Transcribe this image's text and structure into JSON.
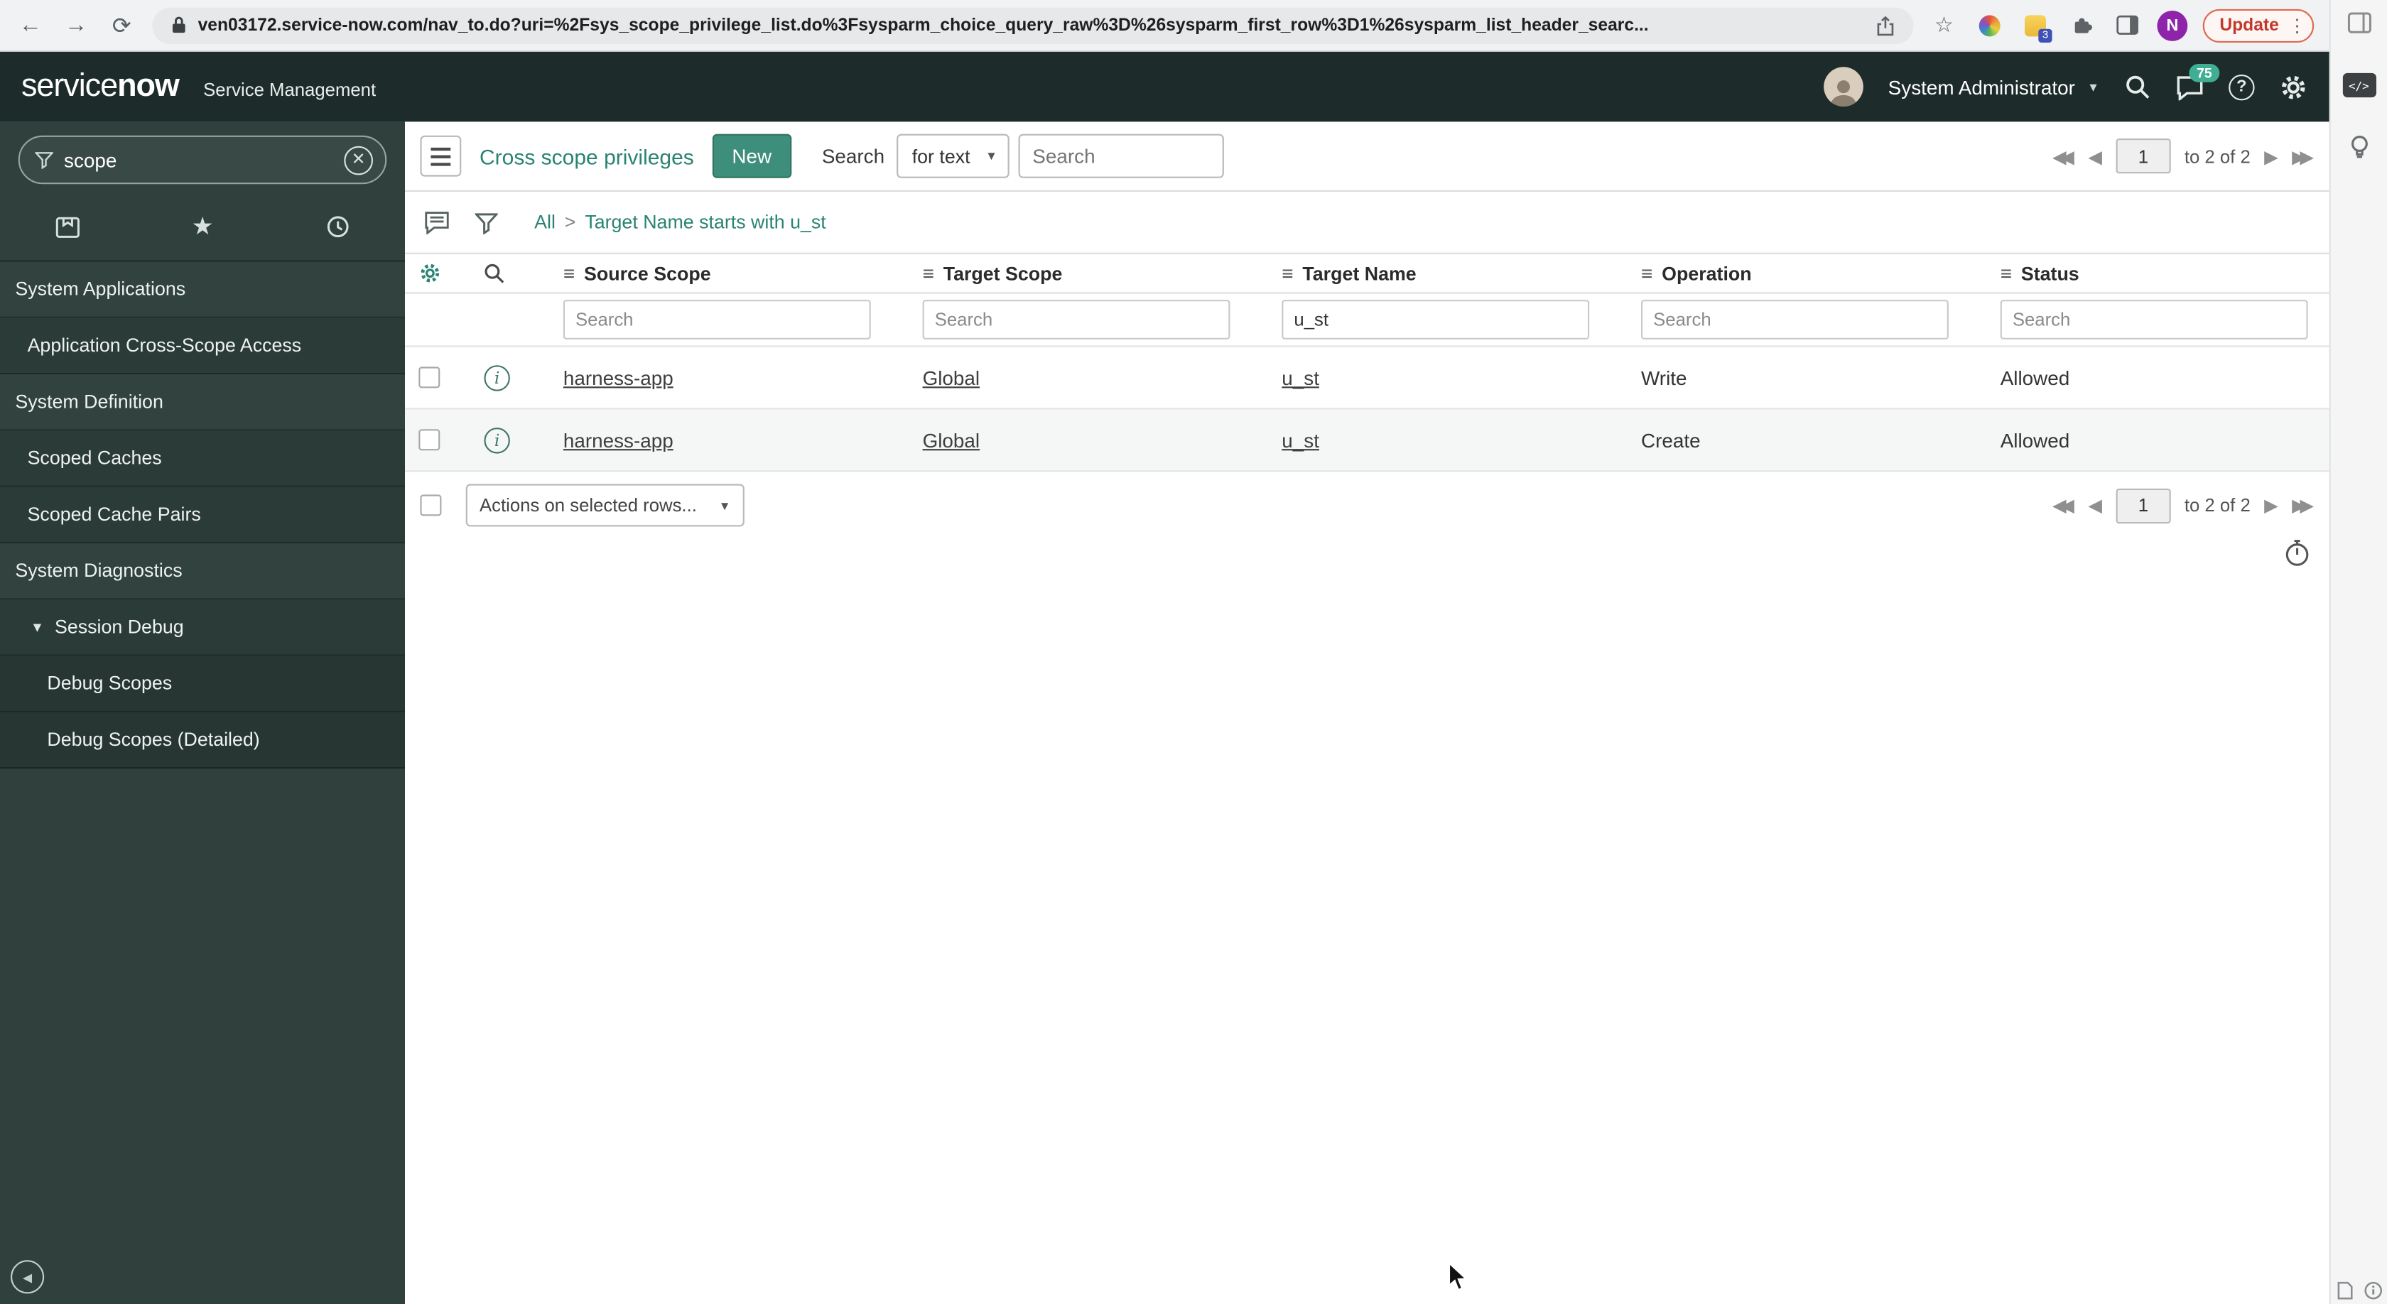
{
  "browser": {
    "url": "ven03172.service-now.com/nav_to.do?uri=%2Fsys_scope_privilege_list.do%3Fsysparm_choice_query_raw%3D%26sysparm_first_row%3D1%26sysparm_list_header_searc...",
    "update_label": "Update",
    "menu_dots": "⋮",
    "extension_badge": "3",
    "profile_initial": "N",
    "code_badge": "</>"
  },
  "banner": {
    "logo_light": "service",
    "logo_bold": "now",
    "product": "Service Management",
    "user": "System Administrator",
    "notification_count": "75"
  },
  "sidebar": {
    "filter_value": "scope",
    "items": [
      {
        "label": "System Applications"
      },
      {
        "label": "Application Cross-Scope Access"
      },
      {
        "label": "System Definition"
      },
      {
        "label": "Scoped Caches"
      },
      {
        "label": "Scoped Cache Pairs"
      },
      {
        "label": "System Diagnostics"
      },
      {
        "label": "Session Debug"
      },
      {
        "label": "Debug Scopes"
      },
      {
        "label": "Debug Scopes (Detailed)"
      }
    ]
  },
  "list": {
    "title": "Cross scope privileges",
    "new_button": "New",
    "search_label": "Search",
    "search_type": "for text",
    "search_placeholder": "Search",
    "breadcrumb_all": "All",
    "breadcrumb_separator": ">",
    "breadcrumb_filter": "Target Name starts with u_st",
    "columns": [
      "Source Scope",
      "Target Scope",
      "Target Name",
      "Operation",
      "Status"
    ],
    "filter_placeholder": "Search",
    "target_name_filter": "u_st",
    "rows": [
      {
        "source_scope": "harness-app",
        "target_scope": "Global",
        "target_name": "u_st",
        "operation": "Write",
        "status": "Allowed"
      },
      {
        "source_scope": "harness-app",
        "target_scope": "Global",
        "target_name": "u_st",
        "operation": "Create",
        "status": "Allowed"
      }
    ],
    "actions_label": "Actions on selected rows...",
    "page_value": "1",
    "page_label": "to 2 of 2"
  }
}
